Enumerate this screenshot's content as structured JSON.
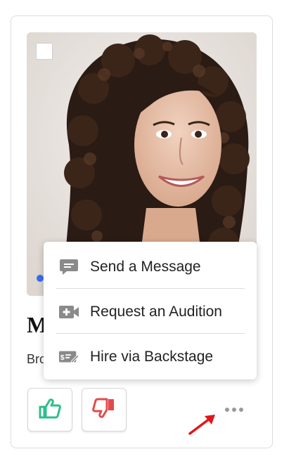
{
  "card": {
    "name_visible": "M",
    "location_visible": "Bro",
    "photo_alt": "headshot-photo"
  },
  "menu": {
    "items": [
      {
        "label": "Send a Message",
        "icon": "message-icon"
      },
      {
        "label": "Request an Audition",
        "icon": "video-camera-icon"
      },
      {
        "label": "Hire via Backstage",
        "icon": "hire-payment-icon"
      }
    ]
  },
  "actions": {
    "thumbs_up_icon": "thumbs-up-icon",
    "thumbs_down_icon": "thumbs-down-icon",
    "more_icon": "more-dots-icon"
  },
  "colors": {
    "thumbs_up": "#2bbf8a",
    "thumbs_down": "#e24b4b",
    "menu_icon": "#8a8a8a",
    "status_dot": "#3a6df0",
    "annotation_arrow": "#e0161b"
  }
}
